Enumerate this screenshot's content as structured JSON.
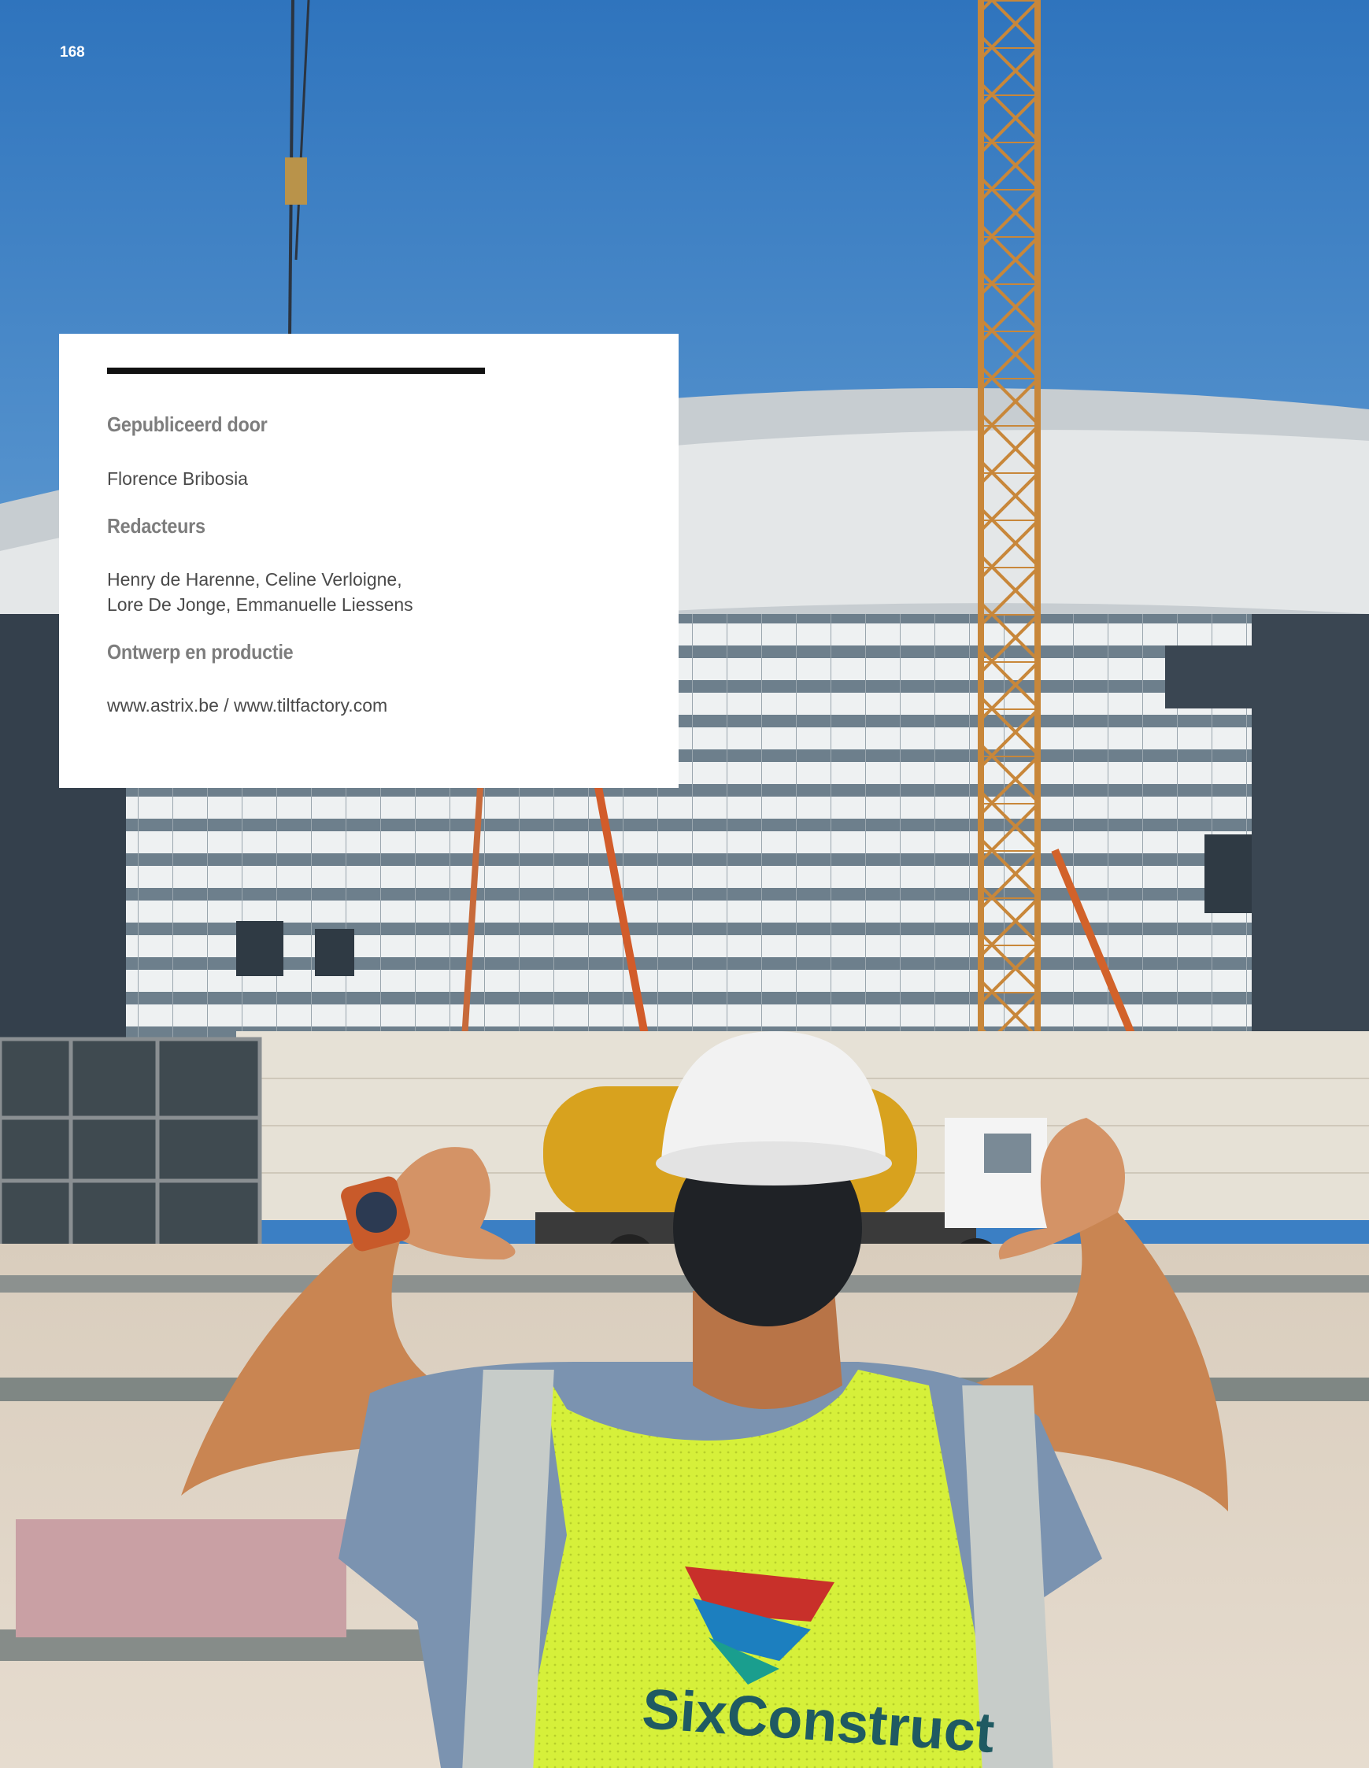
{
  "page_number": "168",
  "colophon": {
    "published_by_heading": "Gepubliceerd door",
    "publisher": "Florence Bribosia",
    "editors_heading": "Redacteurs",
    "editors_line1": "Henry de Harenne, Celine Verloigne,",
    "editors_line2": "Lore De Jonge, Emmanuelle Liessens",
    "design_heading": "Ontwerp en productie",
    "design_credit": "www.astrix.be / www.tiltfactory.com"
  },
  "photo": {
    "vest_logo_text": "SixConstruct"
  },
  "colors": {
    "sky": "#3b7fc4",
    "crane": "#c8873a",
    "vest": "#d6f03a",
    "facade": "#dfe4e6"
  }
}
